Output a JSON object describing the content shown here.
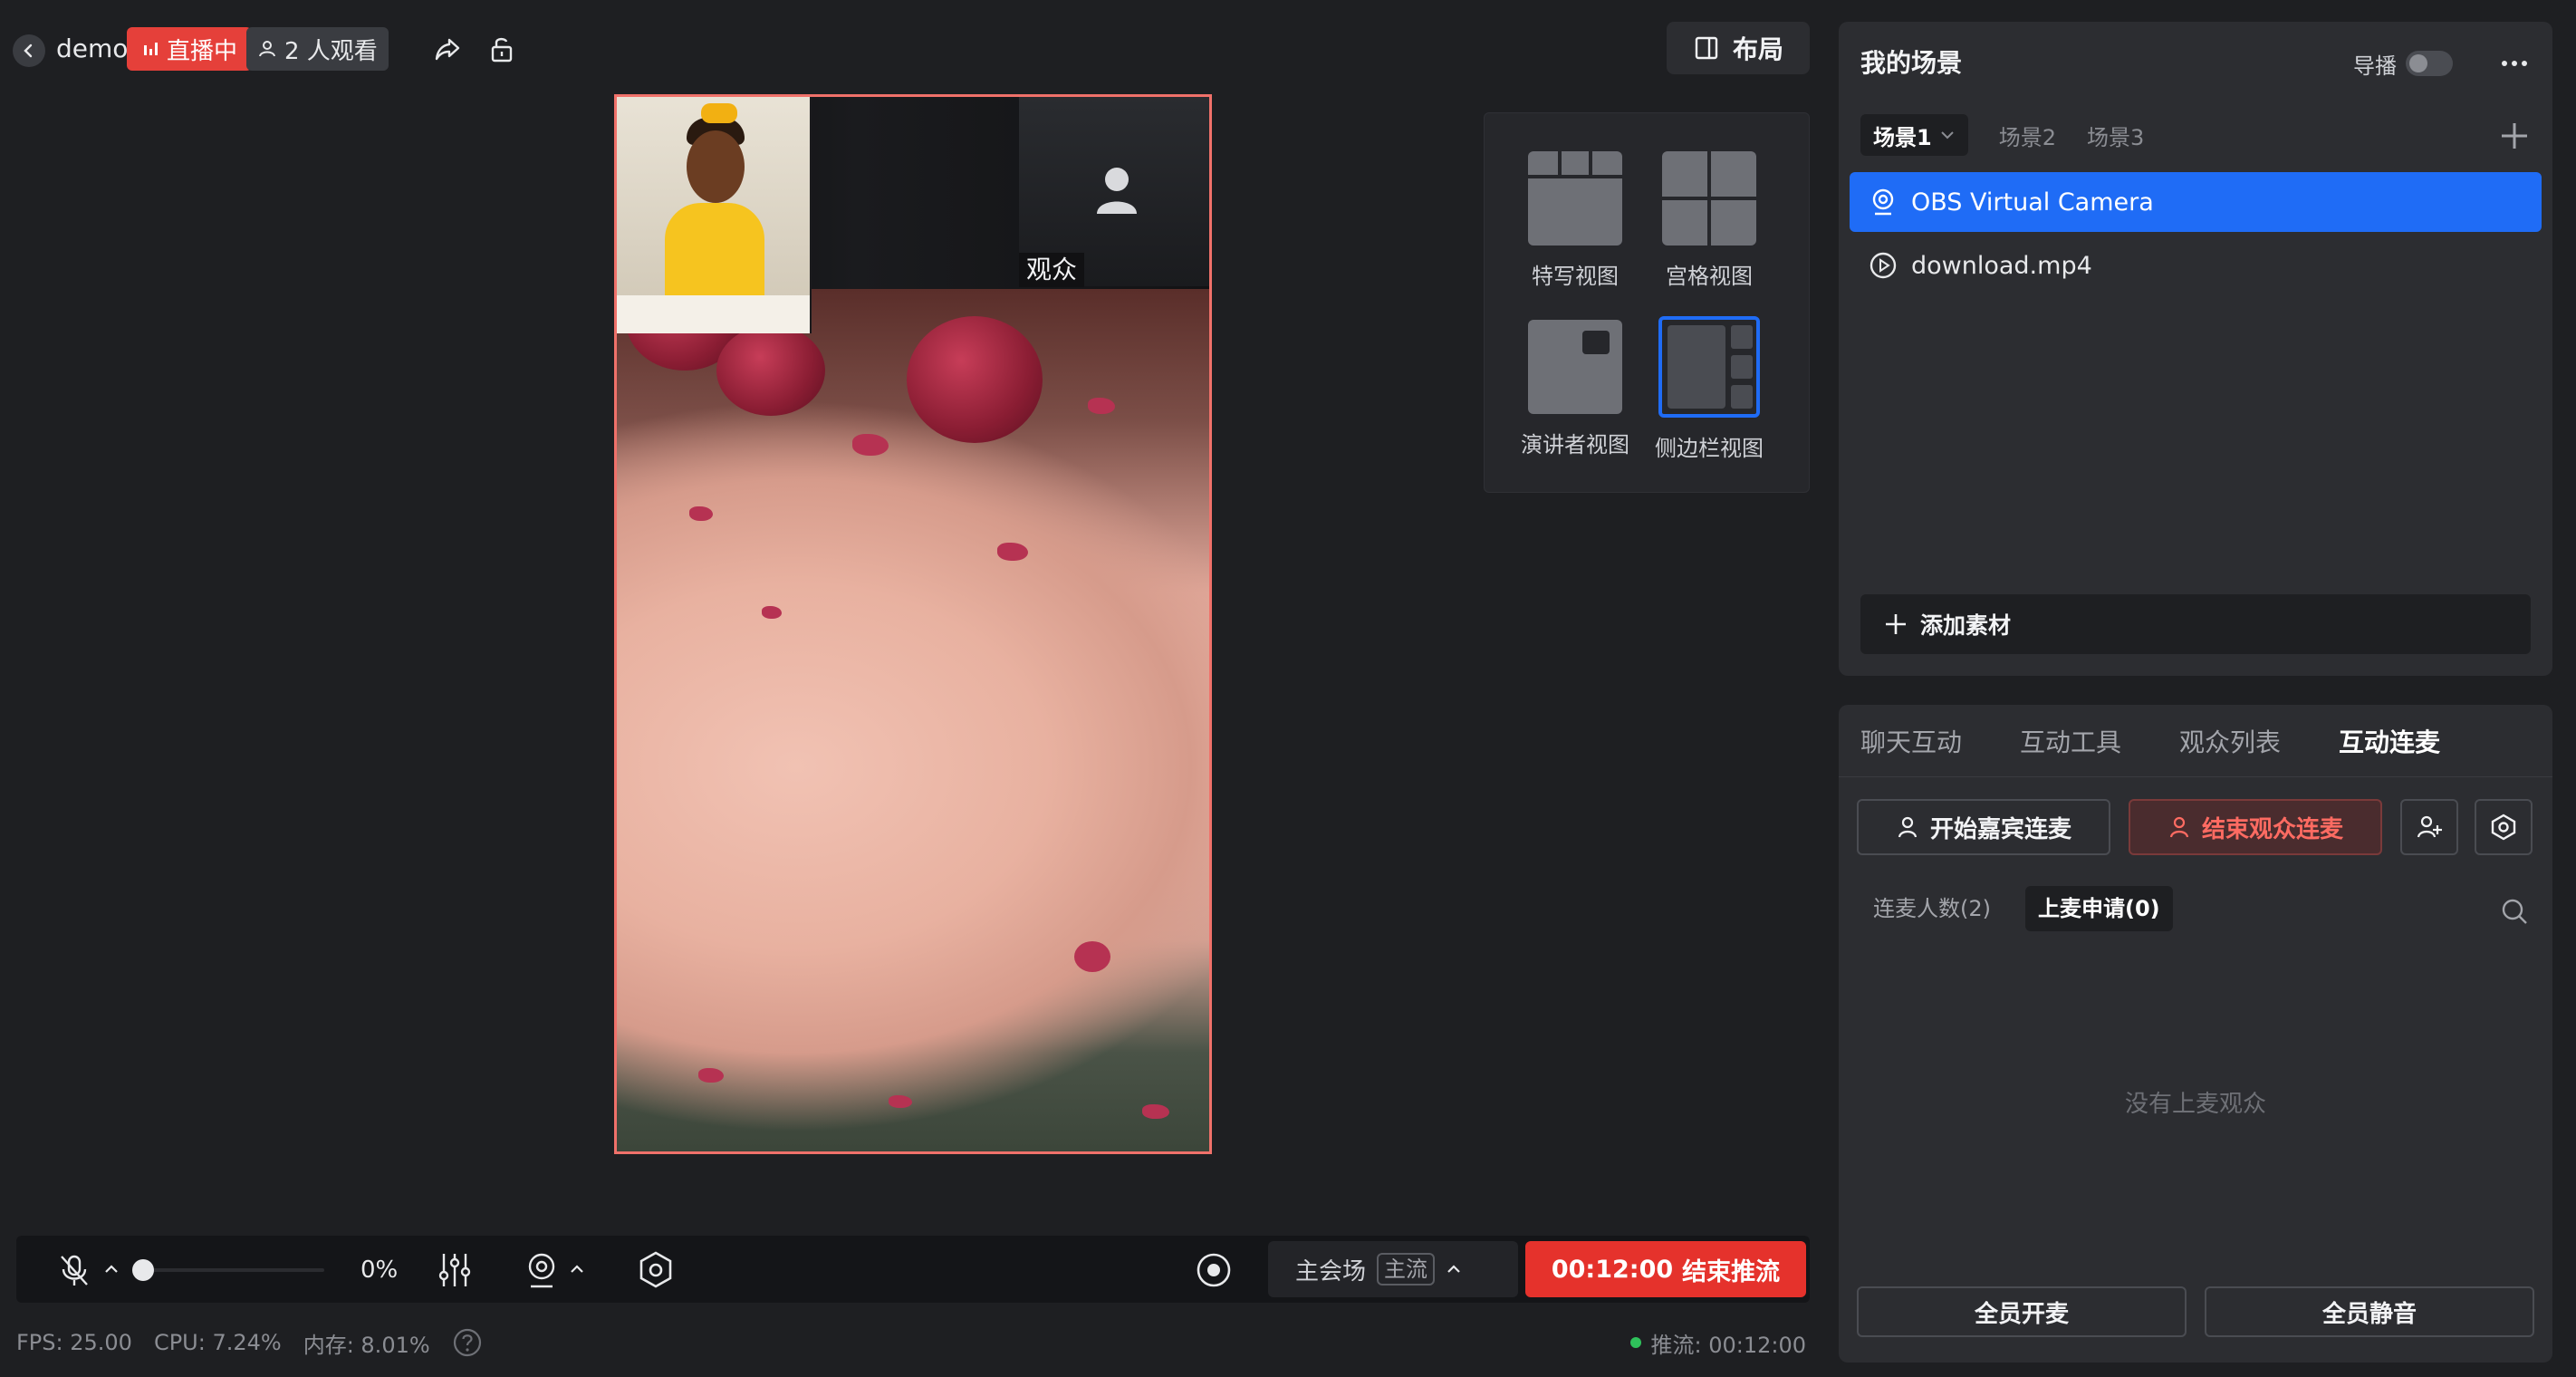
{
  "header": {
    "room_name": "demo",
    "live_badge": "直播中",
    "viewers": "2 人观看",
    "layout_button": "布局"
  },
  "preview": {
    "audience_label": "观众"
  },
  "layout_panel": {
    "options": [
      {
        "label": "特写视图"
      },
      {
        "label": "宫格视图"
      },
      {
        "label": "演讲者视图"
      },
      {
        "label": "侧边栏视图",
        "selected": true
      }
    ]
  },
  "scene_panel": {
    "title": "我的场景",
    "director_label": "导播",
    "tabs": [
      "场景1",
      "场景2",
      "场景3"
    ],
    "active_tab": "场景1",
    "sources": [
      {
        "name": "OBS Virtual Camera",
        "icon": "camera-icon",
        "active": true
      },
      {
        "name": "download.mp4",
        "icon": "play-icon",
        "active": false
      }
    ],
    "add_material": "添加素材"
  },
  "interactive_panel": {
    "tabs": [
      "聊天互动",
      "互动工具",
      "观众列表",
      "互动连麦"
    ],
    "active_tab": "互动连麦",
    "start_guest": "开始嘉宾连麦",
    "end_audience": "结束观众连麦",
    "sub_tabs": [
      "连麦人数(2)",
      "上麦申请(0)"
    ],
    "active_sub_tab": "上麦申请(0)",
    "empty_text": "没有上麦观众",
    "all_unmute": "全员开麦",
    "all_mute": "全员静音"
  },
  "controls": {
    "mic_percent": "0%",
    "mic_level": 0,
    "venue": "主会场",
    "stream_tag": "主流",
    "end_button_time": "00:12:00",
    "end_button_label": "结束推流"
  },
  "status": {
    "fps": "FPS: 25.00",
    "cpu": "CPU: 7.24%",
    "memory": "内存: 8.01%",
    "push": "推流: 00:12:00"
  },
  "colors": {
    "accent": "#1f6cf6",
    "live_red": "#e5403a",
    "end_red": "#e5322c",
    "canvas_border": "#f0716a",
    "status_green": "#2fc25b"
  }
}
